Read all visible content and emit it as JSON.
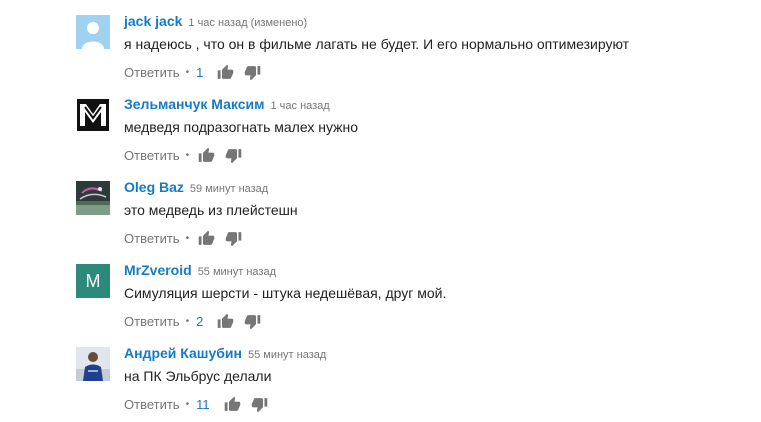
{
  "labels": {
    "reply": "Ответить",
    "separator": "•"
  },
  "colors": {
    "author_link": "#167ac6",
    "secondary_text": "#767676",
    "body_text": "#222222",
    "avatar_m_bg": "#2b8a7a"
  },
  "icons": {
    "like": "thumbs-up-icon",
    "dislike": "thumbs-down-icon"
  },
  "comments": [
    {
      "author": "jack jack",
      "time": "1 час назад",
      "edited": "(изменено)",
      "text": "я надеюсь , что он в фильме лагать не будет. И его нормально оптимезируют",
      "likes": "1",
      "avatar": "default-user-avatar"
    },
    {
      "author": "Зельманчук Максим",
      "time": "1 час назад",
      "edited": "",
      "text": "медведя подразогнать малех нужно",
      "likes": "",
      "avatar": "black-logo-avatar"
    },
    {
      "author": "Oleg Baz",
      "time": "59 минут назад",
      "edited": "",
      "text": "это медведь из плейстешн",
      "likes": "",
      "avatar": "photo-avatar"
    },
    {
      "author": "MrZveroid",
      "time": "55 минут назад",
      "edited": "",
      "text": "Симуляция шерсти - штука недешёвая, друг мой.",
      "likes": "2",
      "avatar": "letter-avatar",
      "avatar_letter": "M"
    },
    {
      "author": "Андрей Кашубин",
      "time": "55 минут назад",
      "edited": "",
      "text": "на ПК Эльбрус делали",
      "likes": "11",
      "avatar": "photo-avatar"
    }
  ]
}
